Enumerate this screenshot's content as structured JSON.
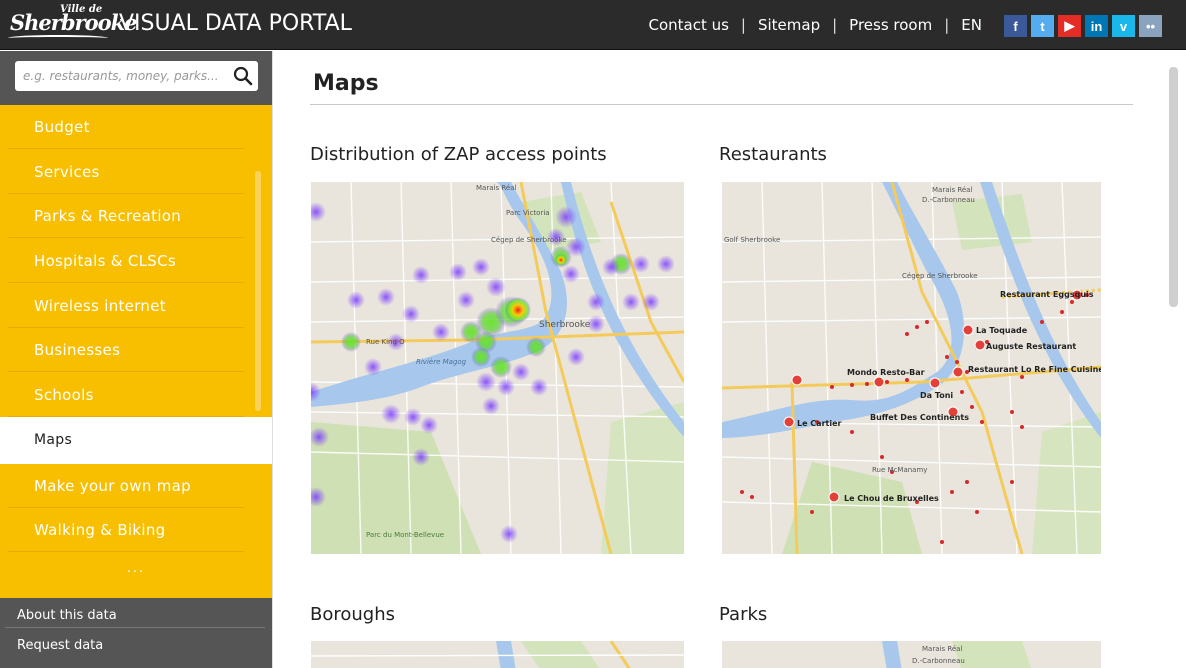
{
  "header": {
    "logo_small": "Ville de",
    "logo_main": "Sherbrooke",
    "title": "VISUAL DATA PORTAL",
    "nav": [
      "Contact us",
      "Sitemap",
      "Press room",
      "EN"
    ],
    "separator": "|",
    "socials": [
      {
        "name": "facebook-icon",
        "glyph": "f",
        "color": "#3b5998"
      },
      {
        "name": "twitter-icon",
        "glyph": "t",
        "color": "#55acee"
      },
      {
        "name": "youtube-icon",
        "glyph": "▶",
        "color": "#e52d27"
      },
      {
        "name": "linkedin-icon",
        "glyph": "in",
        "color": "#0077b5"
      },
      {
        "name": "vimeo-icon",
        "glyph": "v",
        "color": "#1ab7ea"
      },
      {
        "name": "flickr-icon",
        "glyph": "••",
        "color": "#8aa4c0"
      }
    ]
  },
  "search": {
    "placeholder": "e.g. restaurants, money, parks..."
  },
  "menu": {
    "items": [
      "Budget",
      "Services",
      "Parks & Recreation",
      "Hospitals & CLSCs",
      "Wireless internet",
      "Businesses",
      "Schools",
      "Maps",
      "Make your own map",
      "Walking & Biking"
    ],
    "active": "Maps",
    "more": "..."
  },
  "footer_links": [
    "About this data",
    "Request data"
  ],
  "main": {
    "page_title": "Maps",
    "cards": [
      {
        "title": "Distribution of ZAP access points"
      },
      {
        "title": "Restaurants"
      },
      {
        "title": "Boroughs"
      },
      {
        "title": "Parks"
      }
    ]
  },
  "map_labels": {
    "marais": "Marais Réal",
    "carbonneau": "D.-Carbonneau",
    "parc_victoria": "Parc Victoria",
    "cegep": "Cégep de Sherbrooke",
    "sherbrooke": "Sherbrooke",
    "golf": "Golf Sherbrooke",
    "riviere": "Rivière Magog",
    "parc_mont_bellevue": "Parc du Mont-Bellevue",
    "rue_king": "Rue King O",
    "rue_mcmanamy": "Rue McManamy"
  },
  "restaurants": [
    "Restaurant Eggsquis",
    "La Toquade",
    "Auguste Restaurant",
    "Mondo Resto-Bar",
    "Restaurant Lo Re Fine Cuisine Du Marché",
    "Da Toni",
    "Le Cartier",
    "Buffet Des Continents",
    "Le Chou de Bruxelles"
  ],
  "colors": {
    "header_bg": "#2b2b2b",
    "menu_bg": "#f8bf00",
    "sidebar_dark": "#555555"
  }
}
